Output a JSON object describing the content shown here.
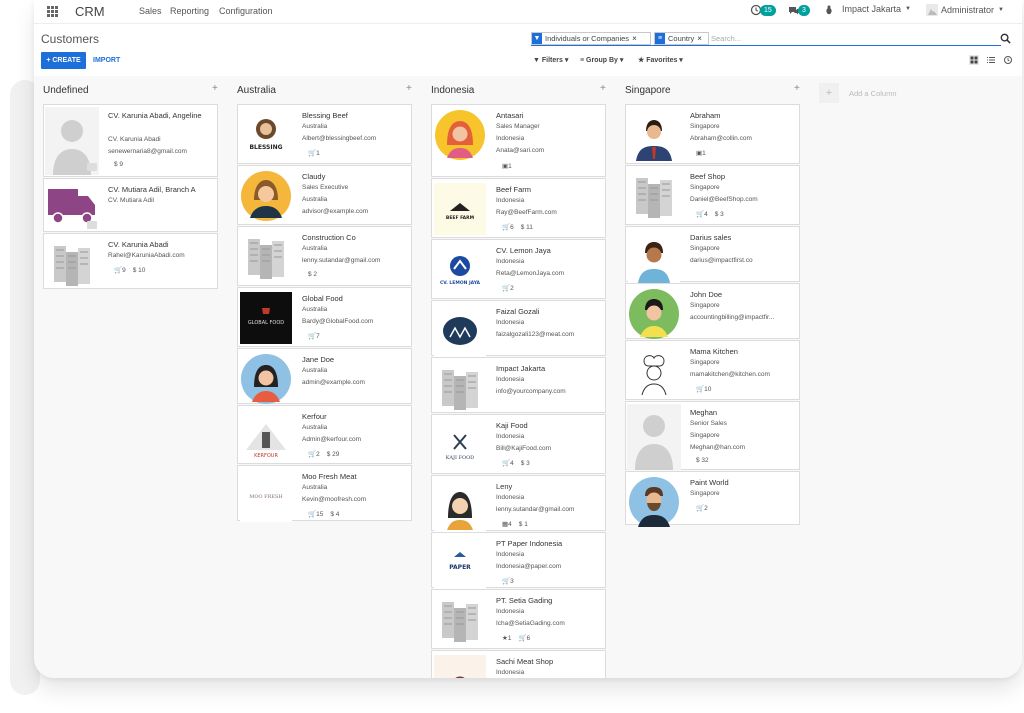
{
  "nav": {
    "brand": "CRM",
    "menu": [
      "Sales",
      "Reporting",
      "Configuration"
    ],
    "activity_count": "15",
    "message_count": "3",
    "company": "Impact Jakarta",
    "user": "Administrator"
  },
  "control": {
    "title": "Customers",
    "create": "+ CREATE",
    "import": "IMPORT",
    "facet_filter_a": "Individuals",
    "facet_filter_or": "or",
    "facet_filter_b": "Companies",
    "facet_group": "Country",
    "search_placeholder": "Search...",
    "filters": "Filters",
    "group_by": "Group By",
    "favorites": "Favorites"
  },
  "add_column": "Add a Column",
  "columns": [
    {
      "title": "Undefined",
      "cards": [
        {
          "name": "CV. Karunia Abadi, Angeline",
          "lines": [
            "CV. Karunia Abadi",
            "senewernaria8@gmail.com"
          ],
          "meta": [
            "$ 9"
          ]
        },
        {
          "name": "CV. Mutiara Adil, Branch A",
          "lines": [
            "CV. Mutiara Adil"
          ],
          "meta": []
        },
        {
          "name": "CV. Karunia Abadi",
          "lines": [
            "Rahel@KaruniaAbadi.com"
          ],
          "meta": [
            "9",
            "$ 10"
          ]
        }
      ]
    },
    {
      "title": "Australia",
      "cards": [
        {
          "name": "Blessing Beef",
          "lines": [
            "Australia",
            "Albert@blessingbeef.com"
          ],
          "meta": [
            "1"
          ]
        },
        {
          "name": "Claudy",
          "lines": [
            "Sales Executive",
            "Australia",
            "advisor@example.com"
          ],
          "meta": []
        },
        {
          "name": "Construction Co",
          "lines": [
            "Australia",
            "lenny.sutandar@gmail.com"
          ],
          "meta": [
            "$ 2"
          ]
        },
        {
          "name": "Global Food",
          "lines": [
            "Australia",
            "Bardy@GlobalFood.com"
          ],
          "meta": [
            "7"
          ]
        },
        {
          "name": "Jane Doe",
          "lines": [
            "Australia",
            "admin@example.com"
          ],
          "meta": []
        },
        {
          "name": "Kerfour",
          "lines": [
            "Australia",
            "Admin@kerfour.com"
          ],
          "meta": [
            "2",
            "$ 29"
          ]
        },
        {
          "name": "Moo Fresh Meat",
          "lines": [
            "Australia",
            "Kevin@moofresh.com"
          ],
          "meta": [
            "15",
            "$ 4"
          ]
        }
      ]
    },
    {
      "title": "Indonesia",
      "cards": [
        {
          "name": "Antasari",
          "lines": [
            "Sales Manager",
            "Indonesia",
            "Anata@sari.com"
          ],
          "meta": [
            "1"
          ]
        },
        {
          "name": "Beef Farm",
          "lines": [
            "Indonesia",
            "Ray@BeefFarm.com"
          ],
          "meta": [
            "6",
            "$ 11"
          ]
        },
        {
          "name": "CV. Lemon Jaya",
          "lines": [
            "Indonesia",
            "Reta@LemonJaya.com"
          ],
          "meta": [
            "2"
          ]
        },
        {
          "name": "Faizal Gozali",
          "lines": [
            "Indonesia",
            "faizalgozali123@meat.com"
          ],
          "meta": []
        },
        {
          "name": "Impact Jakarta",
          "lines": [
            "Indonesia",
            "info@yourcompany.com"
          ],
          "meta": []
        },
        {
          "name": "Kaji Food",
          "lines": [
            "Indonesia",
            "Bill@KajiFood.com"
          ],
          "meta": [
            "4",
            "$ 3"
          ]
        },
        {
          "name": "Leny",
          "lines": [
            "Indonesia",
            "lenny.sutandar@gmail.com"
          ],
          "meta": [
            "4",
            "$ 1"
          ]
        },
        {
          "name": "PT Paper Indonesia",
          "lines": [
            "Indonesia",
            "Indonesia@paper.com"
          ],
          "meta": [
            "3"
          ]
        },
        {
          "name": "PT. Setia Gading",
          "lines": [
            "Indonesia",
            "Icha@SetiaGading.com"
          ],
          "meta": [
            "1",
            "6"
          ]
        },
        {
          "name": "Sachi Meat Shop",
          "lines": [
            "Indonesia"
          ],
          "meta": []
        }
      ]
    },
    {
      "title": "Singapore",
      "cards": [
        {
          "name": "Abraham",
          "lines": [
            "Singapore",
            "Abraham@collin.com"
          ],
          "meta": [
            "1"
          ]
        },
        {
          "name": "Beef Shop",
          "lines": [
            "Singapore",
            "Daniel@BeefShop.com"
          ],
          "meta": [
            "4",
            "$ 3"
          ]
        },
        {
          "name": "Darius sales",
          "lines": [
            "Singapore",
            "darius@impactfirst.co"
          ],
          "meta": []
        },
        {
          "name": "John Doe",
          "lines": [
            "Singapore",
            "accountingbilling@impactfir..."
          ],
          "meta": []
        },
        {
          "name": "Mama Kitchen",
          "lines": [
            "Singapore",
            "mamakitchen@kitchen.com"
          ],
          "meta": [
            "10"
          ]
        },
        {
          "name": "Meghan",
          "lines": [
            "Senior Sales",
            "Singapore",
            "Meghan@han.com"
          ],
          "meta": [
            "$ 32"
          ]
        },
        {
          "name": "Paint World",
          "lines": [
            "Singapore"
          ],
          "meta": [
            "2"
          ]
        }
      ]
    }
  ],
  "logo_texts": {
    "blessing": "BLESSING",
    "global_food": "GLOBAL FOOD",
    "beef_farm": "BEEF FARM",
    "lemon_jaya": "CV. LEMON JAYA",
    "kerfour": "KERFOUR",
    "kaji_food": "KAJI FOOD",
    "paper": "PAPER",
    "moo_fresh": "MOO FRESH"
  },
  "colors": {
    "accent": "#1e6fd9",
    "badge": "#00a09d",
    "truck": "#8e4585"
  }
}
